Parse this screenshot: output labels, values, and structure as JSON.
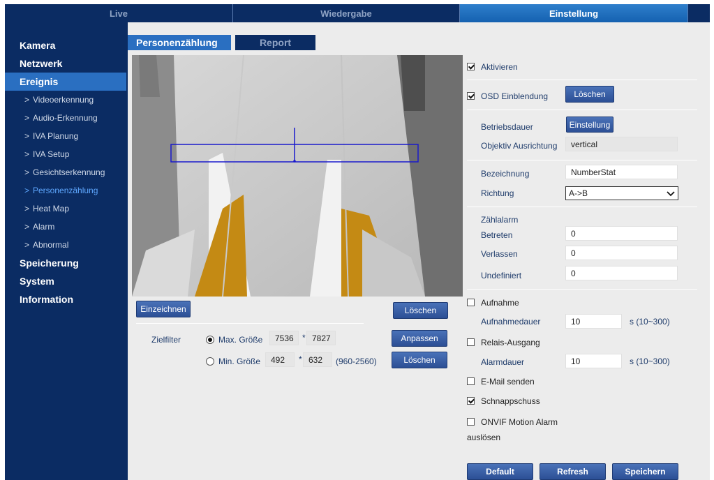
{
  "topnav": {
    "tabs": [
      "Live",
      "Wiedergabe",
      "Einstellung"
    ],
    "active": 2
  },
  "sidebar": {
    "groups": {
      "kamera": "Kamera",
      "netzwerk": "Netzwerk",
      "ereignis": "Ereignis",
      "speicherung": "Speicherung",
      "system": "System",
      "information": "Information"
    },
    "chevron": ">",
    "items": [
      "Videoerkennung",
      "Audio-Erkennung",
      "IVA Planung",
      "IVA Setup",
      "Gesichtserkennung",
      "Personenzählung",
      "Heat Map",
      "Alarm",
      "Abnormal"
    ],
    "active_item": "Personenzählung"
  },
  "tabs": {
    "personen": "Personenzählung",
    "report": "Report"
  },
  "video": {
    "draw_button": "Einzeichnen",
    "clear_button": "Löschen"
  },
  "zielfilter": {
    "label": "Zielfilter",
    "max_label": "Max. Größe",
    "max_w": "7536",
    "max_h": "7827",
    "min_label": "Min. Größe",
    "min_w": "492",
    "min_h": "632",
    "times": "*",
    "range": "(960-2560)",
    "adjust_button": "Anpassen",
    "clear_button": "Löschen"
  },
  "settings": {
    "aktivieren": "Aktivieren",
    "osd": "OSD Einblendung",
    "osd_clear": "Löschen",
    "betriebsdauer": "Betriebsdauer",
    "einstellung_button": "Einstellung",
    "objektiv_label": "Objektiv Ausrichtung",
    "objektiv_value": "vertical",
    "bezeichnung_label": "Bezeichnung",
    "bezeichnung_value": "NumberStat",
    "richtung_label": "Richtung",
    "richtung_value": "A->B",
    "zaehlalarm": "Zählalarm",
    "betreten_label": "Betreten",
    "betreten_value": "0",
    "verlassen_label": "Verlassen",
    "verlassen_value": "0",
    "undefiniert_label": "Undefiniert",
    "undefiniert_value": "0",
    "aufnahme": "Aufnahme",
    "aufnahmedauer_label": "Aufnahmedauer",
    "aufnahmedauer_value": "10",
    "aufnahmedauer_unit": "s (10~300)",
    "relais": "Relais-Ausgang",
    "alarmdauer_label": "Alarmdauer",
    "alarmdauer_value": "10",
    "alarmdauer_unit": "s (10~300)",
    "email": "E-Mail senden",
    "schnappschuss": "Schnappschuss",
    "onvif_line1": "ONVIF Motion Alarm",
    "onvif_line2": "auslösen"
  },
  "footer": {
    "default": "Default",
    "refresh": "Refresh",
    "save": "Speichern"
  },
  "colors": {
    "nav_bg": "#0b2c63",
    "accent": "#2a6fc1",
    "active_item": "#5fa8ff",
    "button": "#3a62a8"
  }
}
